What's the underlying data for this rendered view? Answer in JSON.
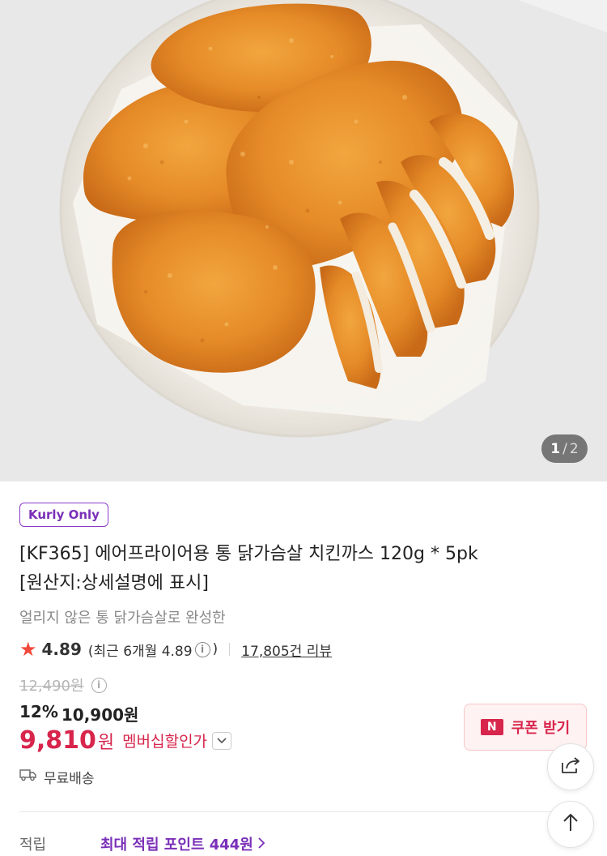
{
  "gallery": {
    "current": "1",
    "separator": "/",
    "total": "2"
  },
  "product": {
    "badge": "Kurly Only",
    "title_line1": "[KF365] 에어프라이어용 통 닭가슴살 치킨까스 120g * 5pk",
    "title_line2": "[원산지:상세설명에 표시]",
    "subtitle": "얼리지 않은 통 닭가슴살로 완성한"
  },
  "rating": {
    "score": "4.89",
    "recent_prefix": "(최근 6개월 4.89",
    "recent_suffix": ")",
    "reviews": "17,805건 리뷰"
  },
  "price": {
    "original": "12,490원",
    "discount_rate": "12%",
    "sale": "10,900원",
    "member_price": "9,810",
    "member_won": "원",
    "member_label": "멤버십할인가"
  },
  "coupon": {
    "label": "쿠폰 받기",
    "logo": "N"
  },
  "delivery": {
    "label": "무료배송"
  },
  "points": {
    "label": "적립",
    "value": "최대 적립 포인트 444원"
  },
  "icons": {
    "star": "star-icon",
    "info": "info-icon",
    "chevron": "chevron-down-icon",
    "truck": "truck-icon",
    "share": "share-icon",
    "arrow_up": "arrow-up-icon"
  },
  "colors": {
    "accent": "#d8254c",
    "brand": "#7a2fb8",
    "star": "#f0483a"
  }
}
